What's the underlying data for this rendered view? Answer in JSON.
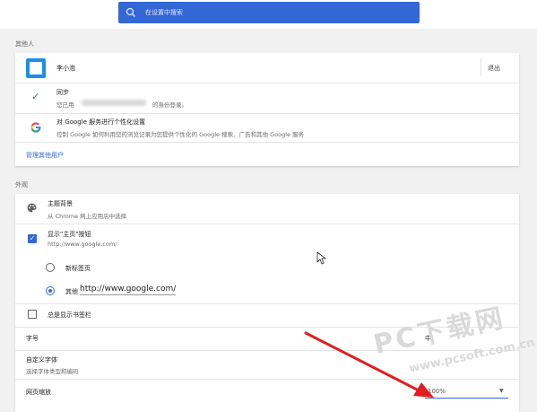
{
  "search": {
    "placeholder": "在设置中搜索"
  },
  "people": {
    "section_title": "其他人",
    "user_name": "李小泡",
    "signout_label": "退出",
    "sync_title": "同步",
    "sync_prefix": "您已用",
    "sync_suffix": "的身份登录。",
    "personalize_title": "对 Google 服务进行个性化设置",
    "personalize_desc": "控制 Google 如何利用您的浏览记录为您提供个性化的 Google 搜索、广告和其他 Google 服务",
    "manage_link": "管理其他用户"
  },
  "appearance": {
    "section_title": "外观",
    "theme_title": "主题背景",
    "theme_desc": "从 Chrome 网上应用店中选择",
    "home_title": "显示\"主页\"按钮",
    "home_url": "http://www.google.com/",
    "home_checked": true,
    "newtab_label": "新标签页",
    "other_label": "其他",
    "other_url": "http://www.google.com/",
    "selected_option": "other",
    "bookmarks_label": "总是显示书签栏",
    "bookmarks_checked": false,
    "font_size_label": "字号",
    "font_size_value": "中",
    "custom_fonts_title": "自定义字体",
    "custom_fonts_desc": "选择字体类型和编码",
    "zoom_label": "网页缩放",
    "zoom_value": "100%"
  },
  "watermark": {
    "line1": "PC下载网",
    "line2": "www.pcsoft.com.cn"
  },
  "colors": {
    "accent": "#3367d6",
    "arrow": "#e02020",
    "windows_blue": "#1e8ee6"
  }
}
